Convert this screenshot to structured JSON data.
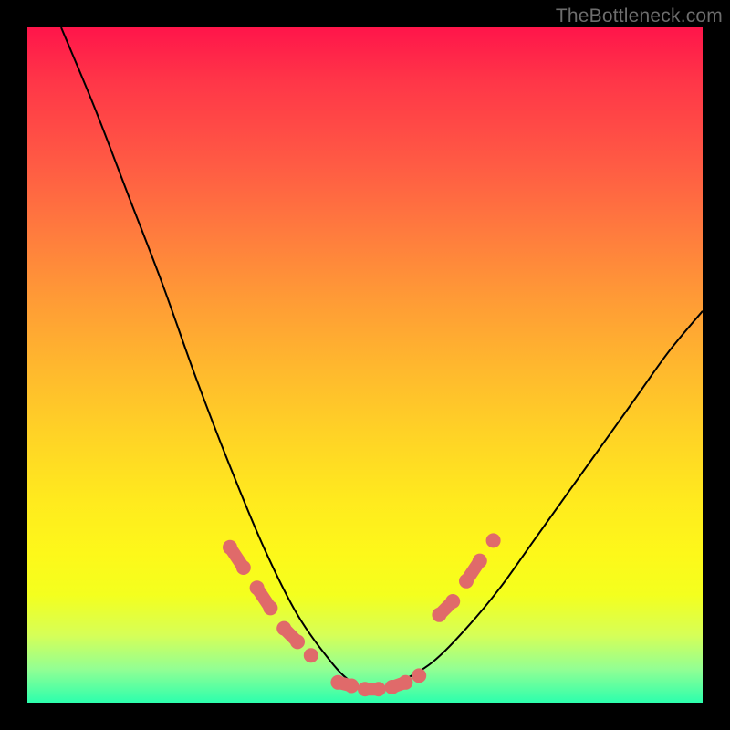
{
  "watermark": "TheBottleneck.com",
  "chart_data": {
    "type": "line",
    "title": "",
    "xlabel": "",
    "ylabel": "",
    "xlim": [
      0,
      100
    ],
    "ylim": [
      0,
      100
    ],
    "grid": false,
    "legend": false,
    "background": "heatmap-gradient-red-to-green-vertical",
    "series": [
      {
        "name": "bottleneck-curve",
        "color": "#000000",
        "x": [
          5,
          10,
          15,
          20,
          25,
          30,
          35,
          40,
          45,
          48,
          50,
          52,
          55,
          60,
          65,
          70,
          75,
          80,
          85,
          90,
          95,
          100
        ],
        "y": [
          100,
          88,
          75,
          62,
          48,
          35,
          23,
          13,
          6,
          3,
          2,
          2,
          3,
          6,
          11,
          17,
          24,
          31,
          38,
          45,
          52,
          58
        ]
      }
    ],
    "markers": [
      {
        "name": "highlighted-points-left",
        "color": "#e06a6a",
        "shape": "rounded-segment",
        "points": [
          {
            "x": 30,
            "y": 23
          },
          {
            "x": 32,
            "y": 20
          },
          {
            "x": 34,
            "y": 17
          },
          {
            "x": 36,
            "y": 14
          },
          {
            "x": 38,
            "y": 11
          },
          {
            "x": 40,
            "y": 9
          },
          {
            "x": 42,
            "y": 7
          }
        ]
      },
      {
        "name": "highlighted-points-bottom",
        "color": "#e06a6a",
        "shape": "rounded-segment",
        "points": [
          {
            "x": 46,
            "y": 3
          },
          {
            "x": 48,
            "y": 2.5
          },
          {
            "x": 50,
            "y": 2
          },
          {
            "x": 52,
            "y": 2
          },
          {
            "x": 54,
            "y": 2.3
          },
          {
            "x": 56,
            "y": 3
          },
          {
            "x": 58,
            "y": 4
          }
        ]
      },
      {
        "name": "highlighted-points-right",
        "color": "#e06a6a",
        "shape": "rounded-segment",
        "points": [
          {
            "x": 61,
            "y": 13
          },
          {
            "x": 63,
            "y": 15
          },
          {
            "x": 65,
            "y": 18
          },
          {
            "x": 67,
            "y": 21
          },
          {
            "x": 69,
            "y": 24
          }
        ]
      }
    ]
  }
}
